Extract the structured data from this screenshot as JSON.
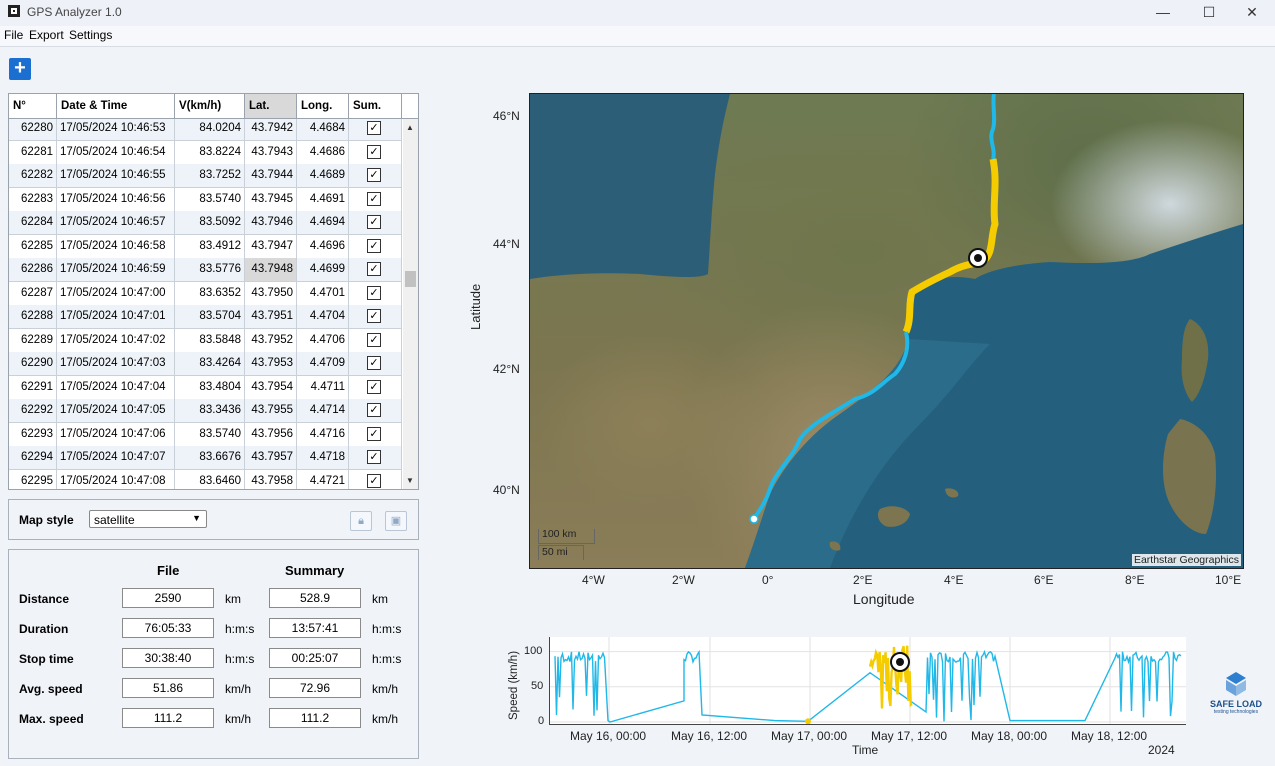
{
  "app": {
    "title": "GPS Analyzer 1.0"
  },
  "menu": [
    "File",
    "Export",
    "Settings"
  ],
  "toolbar": {
    "add_label": "+"
  },
  "table": {
    "headers": [
      "N°",
      "Date & Time",
      "V(km/h)",
      "Lat.",
      "Long.",
      "Sum."
    ],
    "rows": [
      [
        "62280",
        "17/05/2024 10:46:53",
        "84.0204",
        "43.7942",
        "4.4684"
      ],
      [
        "62281",
        "17/05/2024 10:46:54",
        "83.8224",
        "43.7943",
        "4.4686"
      ],
      [
        "62282",
        "17/05/2024 10:46:55",
        "83.7252",
        "43.7944",
        "4.4689"
      ],
      [
        "62283",
        "17/05/2024 10:46:56",
        "83.5740",
        "43.7945",
        "4.4691"
      ],
      [
        "62284",
        "17/05/2024 10:46:57",
        "83.5092",
        "43.7946",
        "4.4694"
      ],
      [
        "62285",
        "17/05/2024 10:46:58",
        "83.4912",
        "43.7947",
        "4.4696"
      ],
      [
        "62286",
        "17/05/2024 10:46:59",
        "83.5776",
        "43.7948",
        "4.4699"
      ],
      [
        "62287",
        "17/05/2024 10:47:00",
        "83.6352",
        "43.7950",
        "4.4701"
      ],
      [
        "62288",
        "17/05/2024 10:47:01",
        "83.5704",
        "43.7951",
        "4.4704"
      ],
      [
        "62289",
        "17/05/2024 10:47:02",
        "83.5848",
        "43.7952",
        "4.4706"
      ],
      [
        "62290",
        "17/05/2024 10:47:03",
        "83.4264",
        "43.7953",
        "4.4709"
      ],
      [
        "62291",
        "17/05/2024 10:47:04",
        "83.4804",
        "43.7954",
        "4.4711"
      ],
      [
        "62292",
        "17/05/2024 10:47:05",
        "83.3436",
        "43.7955",
        "4.4714"
      ],
      [
        "62293",
        "17/05/2024 10:47:06",
        "83.5740",
        "43.7956",
        "4.4716"
      ],
      [
        "62294",
        "17/05/2024 10:47:07",
        "83.6676",
        "43.7957",
        "4.4718"
      ],
      [
        "62295",
        "17/05/2024 10:47:08",
        "83.6460",
        "43.7958",
        "4.4721"
      ]
    ],
    "checkmark": "✓"
  },
  "map_style": {
    "label": "Map style",
    "value": "satellite"
  },
  "stats": {
    "col_file": "File",
    "col_summary": "Summary",
    "rows": [
      {
        "label": "Distance",
        "file": "2590",
        "summary": "528.9",
        "unit": "km"
      },
      {
        "label": "Duration",
        "file": "76:05:33",
        "summary": "13:57:41",
        "unit": "h:m:s"
      },
      {
        "label": "Stop time",
        "file": "30:38:40",
        "summary": "00:25:07",
        "unit": "h:m:s"
      },
      {
        "label": "Avg. speed",
        "file": "51.86",
        "summary": "72.96",
        "unit": "km/h"
      },
      {
        "label": "Max. speed",
        "file": "111.2",
        "summary": "111.2",
        "unit": "km/h"
      }
    ]
  },
  "map": {
    "ylabel": "Latitude",
    "xlabel": "Longitude",
    "y_ticks": [
      "46°N",
      "44°N",
      "42°N",
      "40°N"
    ],
    "x_ticks": [
      "4°W",
      "2°W",
      "0°",
      "2°E",
      "4°E",
      "6°E",
      "8°E",
      "10°E"
    ],
    "scale_km": "100 km",
    "scale_mi": "50 mi",
    "attribution": "Earthstar Geographics",
    "colors": {
      "track": "#1fb8e8",
      "selected": "#f5cc00"
    }
  },
  "chart_data": {
    "type": "line",
    "ylabel": "Speed (km/h)",
    "xlabel": "Time",
    "y_ticks": [
      "0",
      "50",
      "100"
    ],
    "x_ticks": [
      "May 16, 00:00",
      "May 16, 12:00",
      "May 17, 00:00",
      "May 17, 12:00",
      "May 18, 00:00",
      "May 18, 12:00"
    ],
    "x_year": "2024",
    "ylim": [
      0,
      115
    ],
    "series": [
      {
        "color": "#1fb8e8"
      },
      {
        "color": "#f5cc00"
      }
    ]
  },
  "logo": {
    "name": "SAFE LOAD",
    "tagline": "testing technologies"
  }
}
